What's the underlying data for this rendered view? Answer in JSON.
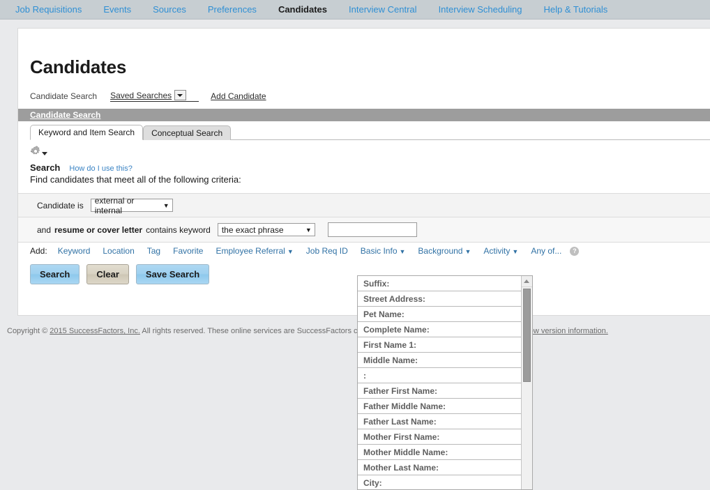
{
  "topnav": {
    "items": [
      {
        "label": "Job Requisitions",
        "active": false
      },
      {
        "label": "Events",
        "active": false
      },
      {
        "label": "Sources",
        "active": false
      },
      {
        "label": "Preferences",
        "active": false
      },
      {
        "label": "Candidates",
        "active": true
      },
      {
        "label": "Interview Central",
        "active": false
      },
      {
        "label": "Interview Scheduling",
        "active": false
      },
      {
        "label": "Help & Tutorials",
        "active": false
      }
    ],
    "active_color": "#1b1b1b",
    "link_color": "#2f8fd4",
    "bar_color": "#c7ced2"
  },
  "page": {
    "title": "Candidates"
  },
  "subnav": {
    "candidate_search": "Candidate Search",
    "saved_searches": "Saved Searches",
    "add_candidate": "Add Candidate"
  },
  "band": {
    "label": "Candidate Search"
  },
  "tabs": [
    {
      "label": "Keyword and Item Search",
      "active": true
    },
    {
      "label": "Conceptual Search",
      "active": false
    }
  ],
  "toolbar": {
    "gear_icon": "gear-icon",
    "gear_caret": "chevron-down-icon"
  },
  "search": {
    "heading": "Search",
    "how_do_i_use_this": "How do I use this?",
    "criteria_note": "Find candidates that meet all of the following criteria:"
  },
  "criteria": {
    "row1": {
      "prefix": "Candidate is",
      "select_value": "external or internal",
      "caret": "▼"
    },
    "row2": {
      "prefix": "and",
      "bold": "resume or cover letter",
      "middle": "contains keyword",
      "select_value": "the exact phrase",
      "caret": "▼",
      "input_value": "",
      "input_placeholder": ""
    }
  },
  "add_row": {
    "label": "Add:",
    "links": [
      {
        "label": "Keyword",
        "dropdown": false
      },
      {
        "label": "Location",
        "dropdown": false
      },
      {
        "label": "Tag",
        "dropdown": false
      },
      {
        "label": "Favorite",
        "dropdown": false
      },
      {
        "label": "Employee Referral",
        "dropdown": true
      },
      {
        "label": "Job Req ID",
        "dropdown": false
      },
      {
        "label": "Basic Info",
        "dropdown": true
      },
      {
        "label": "Background",
        "dropdown": true
      },
      {
        "label": "Activity",
        "dropdown": true
      },
      {
        "label": "Any of...",
        "dropdown": false
      }
    ],
    "help_icon": "help-icon",
    "help_glyph": "?"
  },
  "buttons": {
    "search": "Search",
    "clear": "Clear",
    "save_search": "Save Search"
  },
  "footer": {
    "copyright_prefix": "Copyright © ",
    "copyright_link": "2015 SuccessFactors, Inc.",
    "copyright_rest": " All rights reserved. These online services are SuccessFactors confidential, for SuccessFactors customers only. ",
    "version_link": "Show version information."
  },
  "dropdown": {
    "open_for": "Basic Info",
    "items": [
      "Suffix:",
      "Street Address:",
      "Pet Name:",
      "Complete Name:",
      "First Name 1:",
      "Middle Name:",
      ":",
      "Father First Name:",
      "Father Middle Name:",
      "Father Last Name:",
      "Mother First Name:",
      "Mother Middle Name:",
      "Mother Last Name:",
      "City:"
    ],
    "scroll_up_icon": "scroll-up-arrow-icon"
  }
}
